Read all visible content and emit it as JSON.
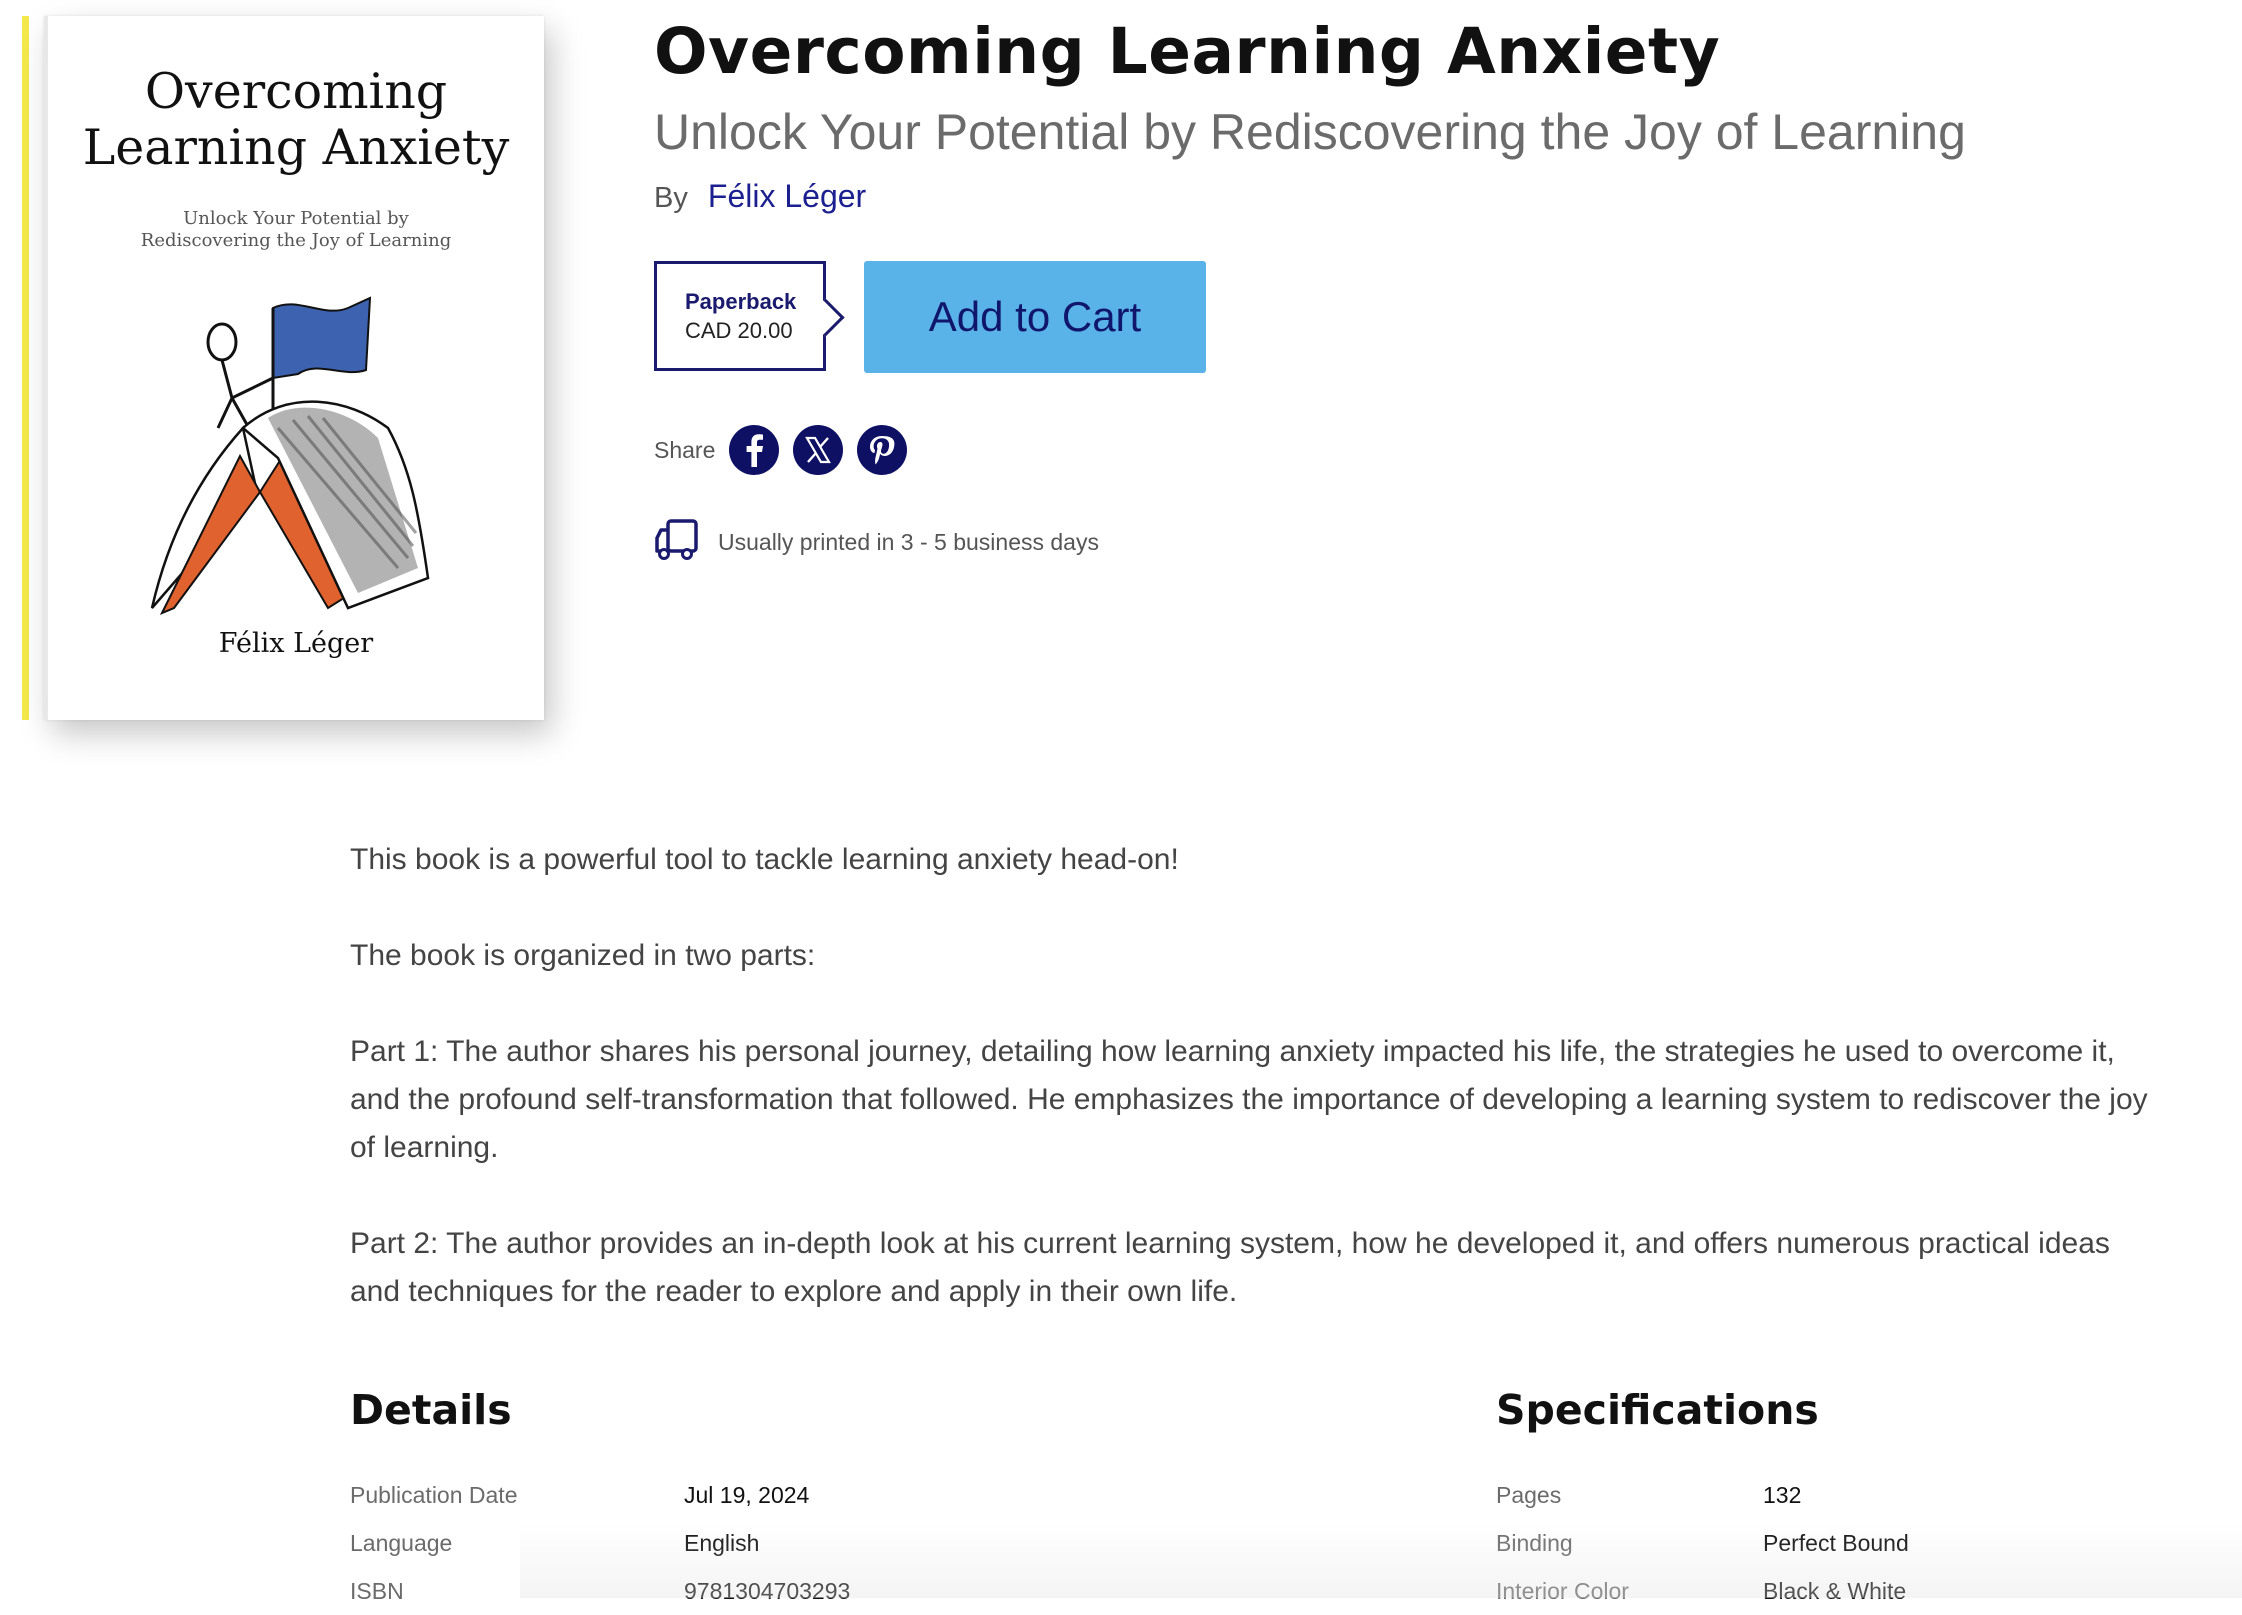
{
  "cover": {
    "title_line1": "Overcoming",
    "title_line2": "Learning Anxiety",
    "subtitle_line1": "Unlock Your Potential by",
    "subtitle_line2": "Rediscovering the Joy of Learning",
    "author": "Félix Léger",
    "spine_color": "#f4e94a"
  },
  "product": {
    "title": "Overcoming Learning Anxiety",
    "subtitle": "Unlock Your Potential by Rediscovering the Joy of Learning",
    "by_label": "By",
    "author": "Félix Léger",
    "format": {
      "name": "Paperback",
      "price": "CAD 20.00"
    },
    "add_to_cart_label": "Add to Cart",
    "share_label": "Share",
    "social": [
      "facebook-icon",
      "x-icon",
      "pinterest-icon"
    ],
    "shipping_text": "Usually printed in 3 - 5 business days"
  },
  "description": [
    "This book is a powerful tool to tackle learning anxiety head-on!",
    "The book is organized in two parts:",
    "Part 1: The author shares his personal journey, detailing how learning anxiety impacted his life, the strategies he used to overcome it, and the profound self-transformation that followed. He emphasizes the importance of developing a learning system to rediscover the joy of learning.",
    "Part 2: The author provides an in-depth look at his current learning system, how he developed it, and offers numerous practical ideas and techniques for the reader to explore and apply in their own life."
  ],
  "details": {
    "title": "Details",
    "rows": [
      {
        "key": "Publication Date",
        "value": "Jul 19, 2024"
      },
      {
        "key": "Language",
        "value": "English"
      },
      {
        "key": "ISBN",
        "value": "9781304703293"
      }
    ]
  },
  "specifications": {
    "title": "Specifications",
    "rows": [
      {
        "key": "Pages",
        "value": "132"
      },
      {
        "key": "Binding",
        "value": "Perfect Bound"
      },
      {
        "key": "Interior Color",
        "value": "Black & White"
      }
    ]
  },
  "colors": {
    "cart_button": "#5ab3e8",
    "navy": "#1a1a6e"
  }
}
